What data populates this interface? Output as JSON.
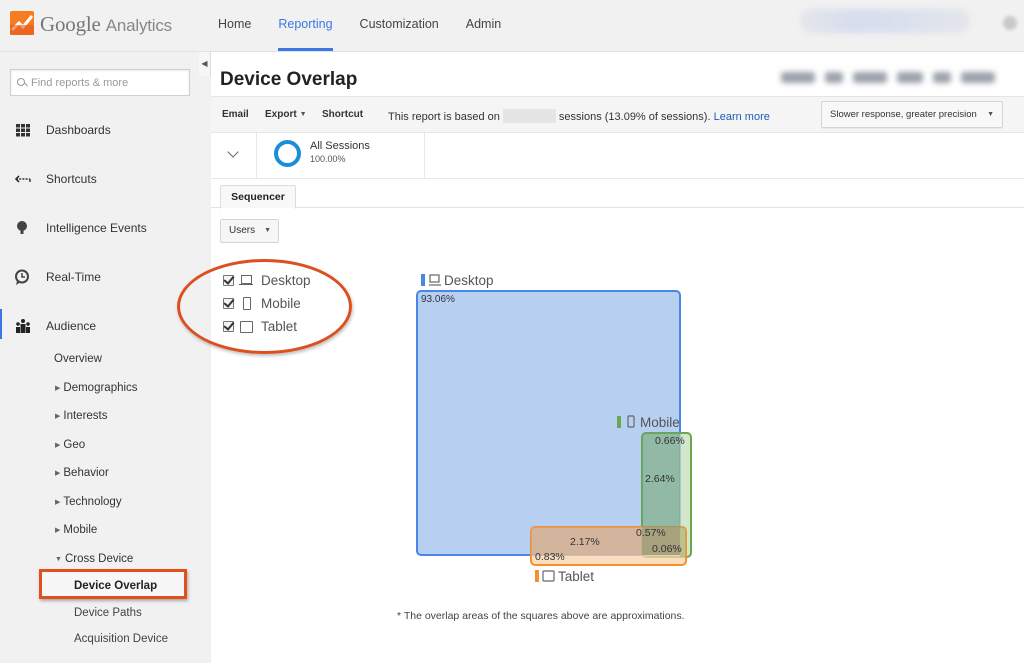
{
  "app": {
    "brand_google": "Google",
    "brand_product": "Analytics",
    "nav": [
      {
        "label": "Home",
        "active": false
      },
      {
        "label": "Reporting",
        "active": true
      },
      {
        "label": "Customization",
        "active": false
      },
      {
        "label": "Admin",
        "active": false
      }
    ],
    "accent_color": "#3b78e7"
  },
  "sidebar": {
    "search_placeholder": "Find reports & more",
    "items": [
      {
        "label": "Dashboards",
        "icon": "grid-icon"
      },
      {
        "label": "Shortcuts",
        "icon": "shortcut-arrow-icon"
      },
      {
        "label": "Intelligence Events",
        "icon": "lightbulb-icon"
      },
      {
        "label": "Real-Time",
        "icon": "clock-icon"
      },
      {
        "label": "Audience",
        "icon": "people-icon",
        "active": true
      }
    ],
    "audience_sub": {
      "overview": "Overview",
      "groups": [
        "Demographics",
        "Interests",
        "Geo",
        "Behavior",
        "Technology",
        "Mobile"
      ],
      "cross_device": "Cross Device",
      "cross_device_items": [
        "Device Overlap",
        "Device Paths",
        "Acquisition Device"
      ],
      "selected": "Device Overlap"
    }
  },
  "report": {
    "title": "Device Overlap",
    "toolbar": {
      "email": "Email",
      "export": "Export",
      "shortcut": "Shortcut",
      "info_prefix": "This report is based on",
      "info_suffix": "sessions (13.09% of sessions).",
      "learn_more": "Learn more",
      "precision": "Slower response, greater precision"
    },
    "segment": {
      "name": "All Sessions",
      "percent": "100.00%",
      "color": "#1a8fd6"
    },
    "tab": "Sequencer",
    "metric_dropdown": "Users",
    "device_filters": [
      {
        "label": "Desktop",
        "checked": true,
        "icon": "desktop-icon"
      },
      {
        "label": "Mobile",
        "checked": true,
        "icon": "mobile-icon"
      },
      {
        "label": "Tablet",
        "checked": true,
        "icon": "tablet-icon"
      }
    ],
    "footnote": "* The overlap areas of the squares above are approximations."
  },
  "chart_data": {
    "type": "venn-squares",
    "title": "Device Overlap",
    "sets": [
      {
        "name": "Desktop",
        "color": "#4a86e8",
        "fill": "#b7d0f2",
        "only_pct": "93.06%"
      },
      {
        "name": "Mobile",
        "color": "#6aa84f",
        "fill": "#c5dfb9",
        "only_pct": "0.66%"
      },
      {
        "name": "Tablet",
        "color": "#f6902c",
        "fill": "#f9d3a9",
        "only_pct": "0.83%"
      }
    ],
    "overlaps": [
      {
        "sets": [
          "Desktop",
          "Mobile"
        ],
        "pct": "2.64%"
      },
      {
        "sets": [
          "Desktop",
          "Tablet"
        ],
        "pct": "2.17%"
      },
      {
        "sets": [
          "Desktop",
          "Mobile",
          "Tablet"
        ],
        "pct": "0.57%"
      },
      {
        "sets": [
          "Mobile",
          "Tablet"
        ],
        "pct": "0.06%"
      }
    ]
  }
}
